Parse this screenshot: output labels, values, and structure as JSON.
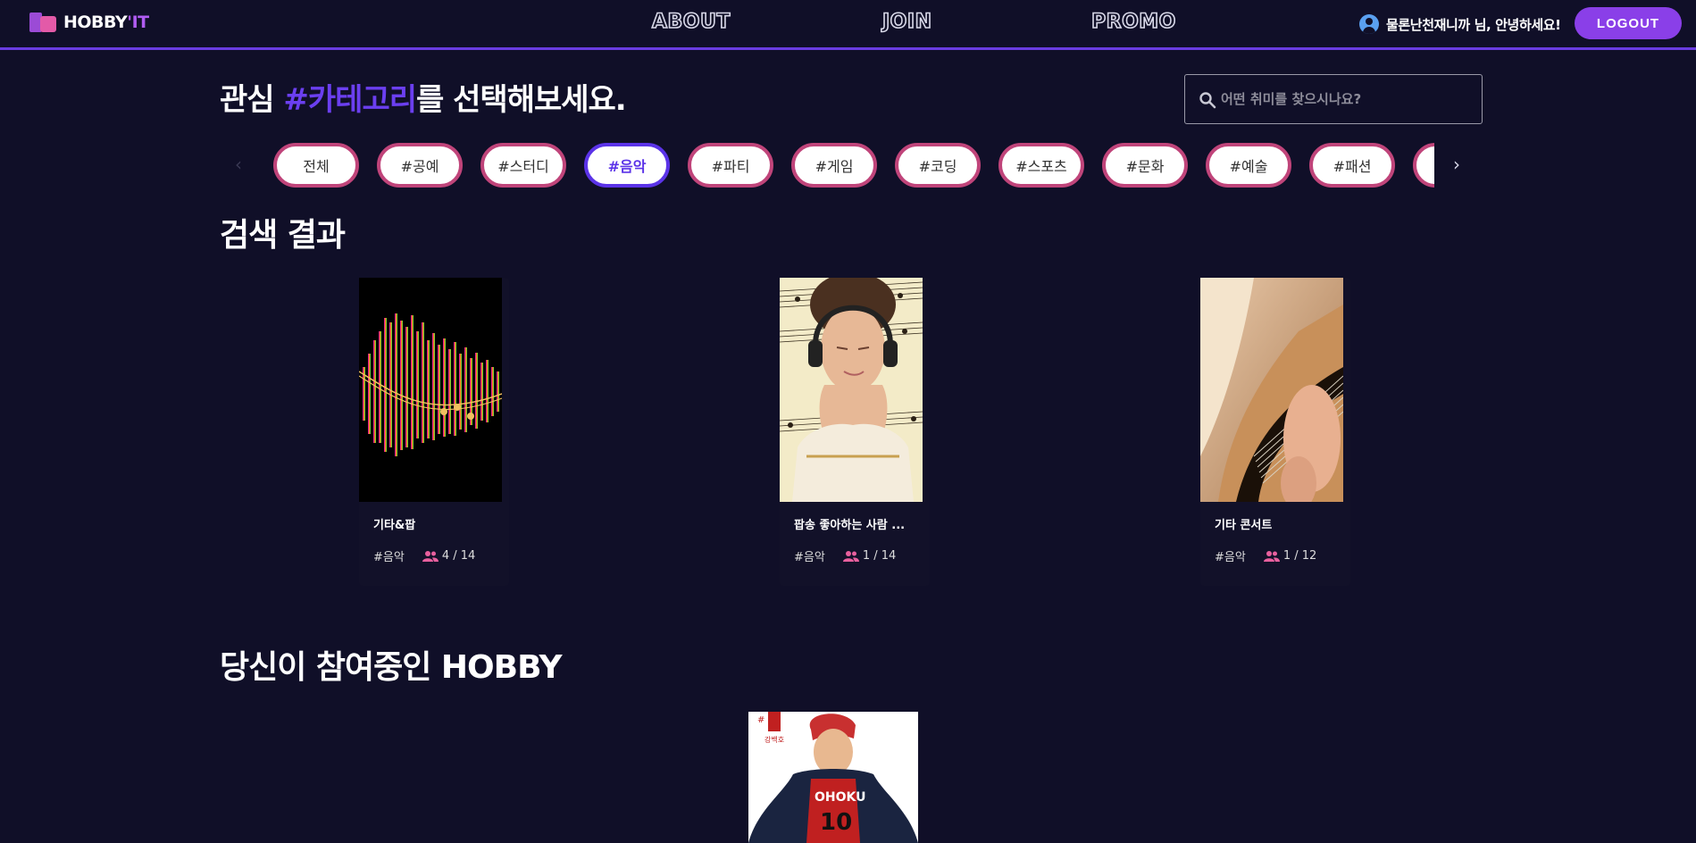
{
  "header": {
    "logo_text": "HOBBY",
    "logo_accent": "'IT",
    "nav": [
      "ABOUT",
      "JOIN",
      "PROMO"
    ],
    "user_greeting": "물론난천재니까 님, 안녕하세요!",
    "logout_label": "LOGOUT"
  },
  "headline": {
    "prefix": "관심 ",
    "highlight": "#카테고리",
    "suffix": "를 선택해보세요."
  },
  "search": {
    "placeholder": "어떤 취미를 찾으시나요?"
  },
  "categories": {
    "prev_icon": "‹",
    "next_icon": "›",
    "items": [
      "전체",
      "#공예",
      "#스터디",
      "#음악",
      "#파티",
      "#게임",
      "#코딩",
      "#스포츠",
      "#문화",
      "#예술",
      "#패션",
      ""
    ],
    "active": "#음악"
  },
  "results": {
    "title": "검색 결과",
    "cards": [
      {
        "title": "기타&팝",
        "category": "#음악",
        "members": "4 / 14",
        "image": "music-waveform"
      },
      {
        "title": "팝송 좋아하는 사람 ...",
        "category": "#음악",
        "members": "1 / 14",
        "image": "girl-headphones"
      },
      {
        "title": "기타 콘서트",
        "category": "#음악",
        "members": "1 / 12",
        "image": "guitar-closeup"
      }
    ]
  },
  "joined": {
    "title": "당신이 참여중인 HOBBY",
    "image": "comic-cover"
  },
  "colors": {
    "background": "#100f28",
    "accent_purple": "#6b3ff0",
    "button_purple": "#8a3fe8",
    "chip_border": "#c0447a",
    "people_icon": "#e8609e"
  }
}
